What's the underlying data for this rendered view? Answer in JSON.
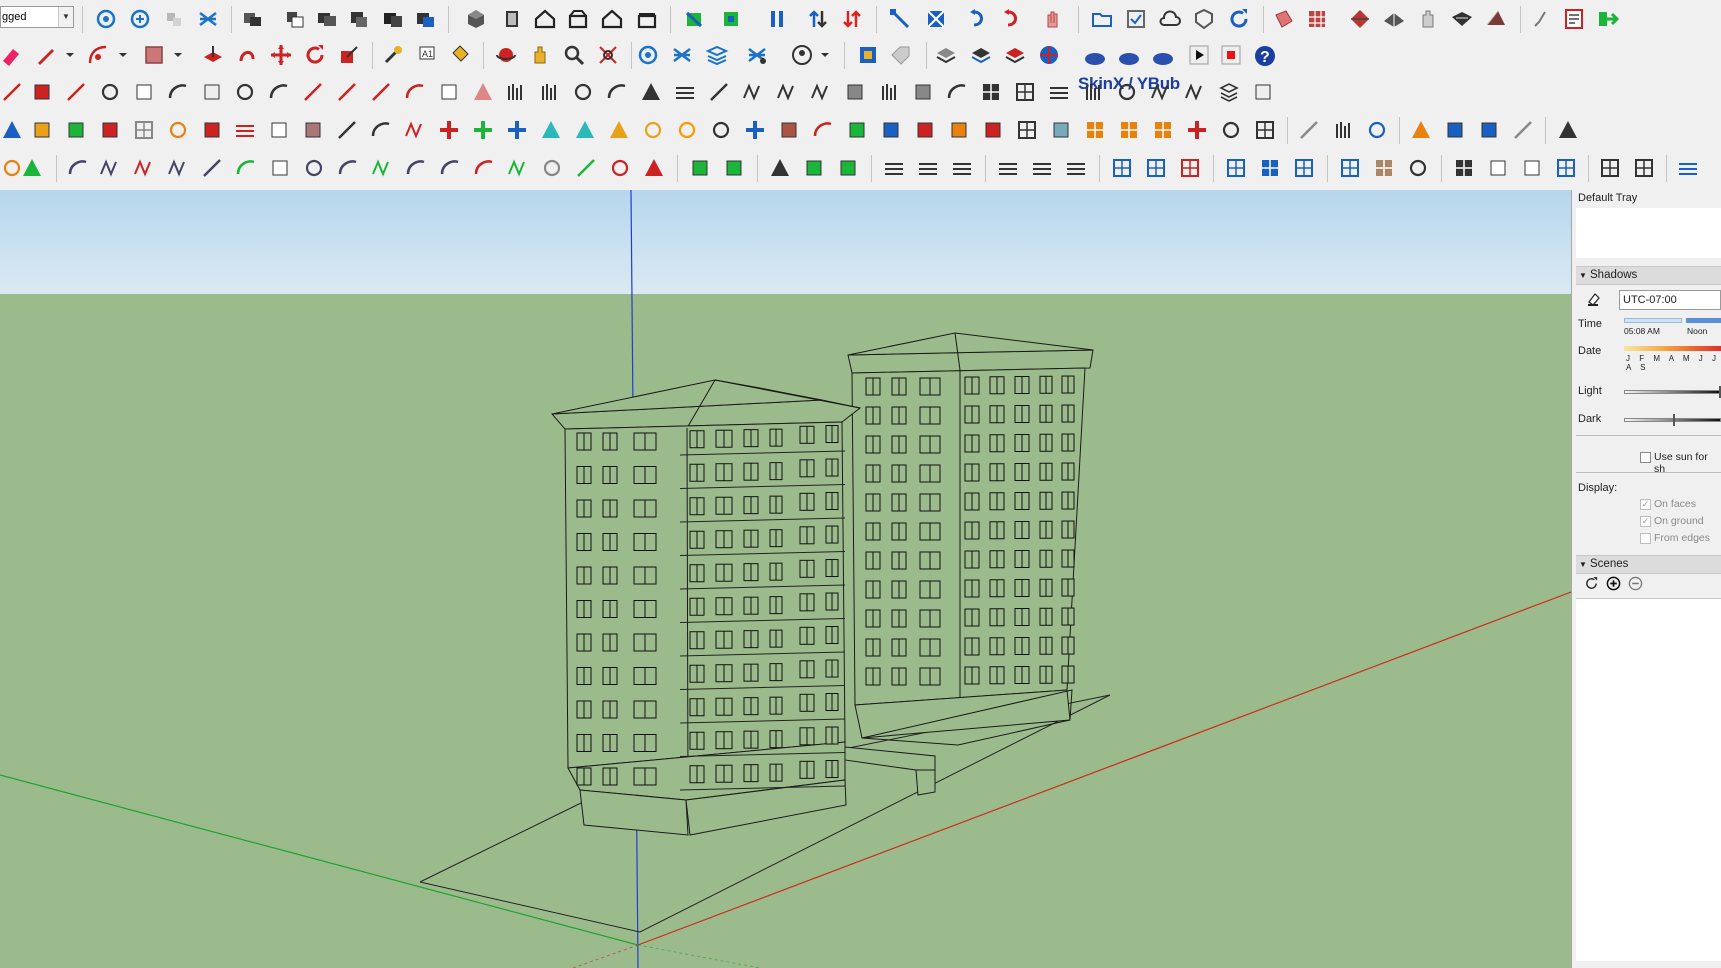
{
  "app": {
    "layer_dropdown_value": "gged"
  },
  "toolbar": {
    "skinx_label": "SkinX / YBub"
  },
  "tray": {
    "title": "Default Tray",
    "shadows": {
      "header": "Shadows",
      "timezone": "UTC-07:00",
      "time_label": "Time",
      "time_start": "05:08 AM",
      "time_mid": "Noon",
      "date_label": "Date",
      "months": "J F M A M J J A S",
      "light_label": "Light",
      "light_level": 0.98,
      "dark_label": "Dark",
      "dark_level": 0.5,
      "use_sun_label": "Use sun for sh",
      "use_sun_checked": false,
      "display_label": "Display:",
      "on_faces_label": "On faces",
      "on_faces_checked": true,
      "on_ground_label": "On ground",
      "on_ground_checked": true,
      "from_edges_label": "From edges",
      "from_edges_checked": false
    },
    "scenes": {
      "header": "Scenes"
    }
  },
  "colors": {
    "sky_top": "#b6d6ee",
    "sky_horizon": "#dbe9f2",
    "ground": "#9cbb8c",
    "axis_red": "#cc2a1f",
    "axis_green": "#1ca532",
    "axis_blue": "#1e3fcc"
  }
}
